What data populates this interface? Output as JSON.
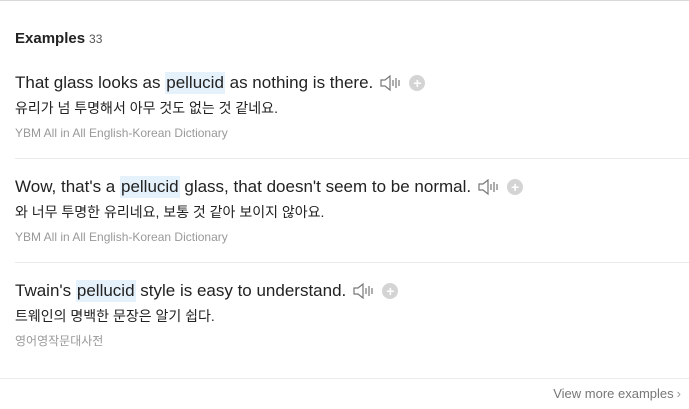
{
  "section": {
    "title": "Examples",
    "count": "33"
  },
  "examples": [
    {
      "en_before": "That glass looks as ",
      "en_highlight": "pellucid",
      "en_after": " as nothing is there.",
      "ko": "유리가 넘 투명해서 아무 것도 없는 것 같네요.",
      "source": "YBM All in All English-Korean Dictionary"
    },
    {
      "en_before": "Wow, that's a ",
      "en_highlight": "pellucid",
      "en_after": " glass, that doesn't seem to be normal.",
      "ko": "와 너무 투명한 유리네요, 보통 것 같아 보이지 않아요.",
      "source": "YBM All in All English-Korean Dictionary"
    },
    {
      "en_before": "Twain's ",
      "en_highlight": "pellucid",
      "en_after": " style is easy to understand.",
      "ko": "트웨인의 명백한 문장은 알기 쉽다.",
      "source": "영어영작문대사전"
    }
  ],
  "footer": {
    "view_more": "View more examples"
  },
  "icons": {
    "speaker": "speaker-icon",
    "add": "plus-circle-icon",
    "chevron": "chevron-right-icon"
  },
  "colors": {
    "highlight": "#e6f2fb",
    "source_text": "#999999",
    "add_button": "#d4d4d4"
  }
}
